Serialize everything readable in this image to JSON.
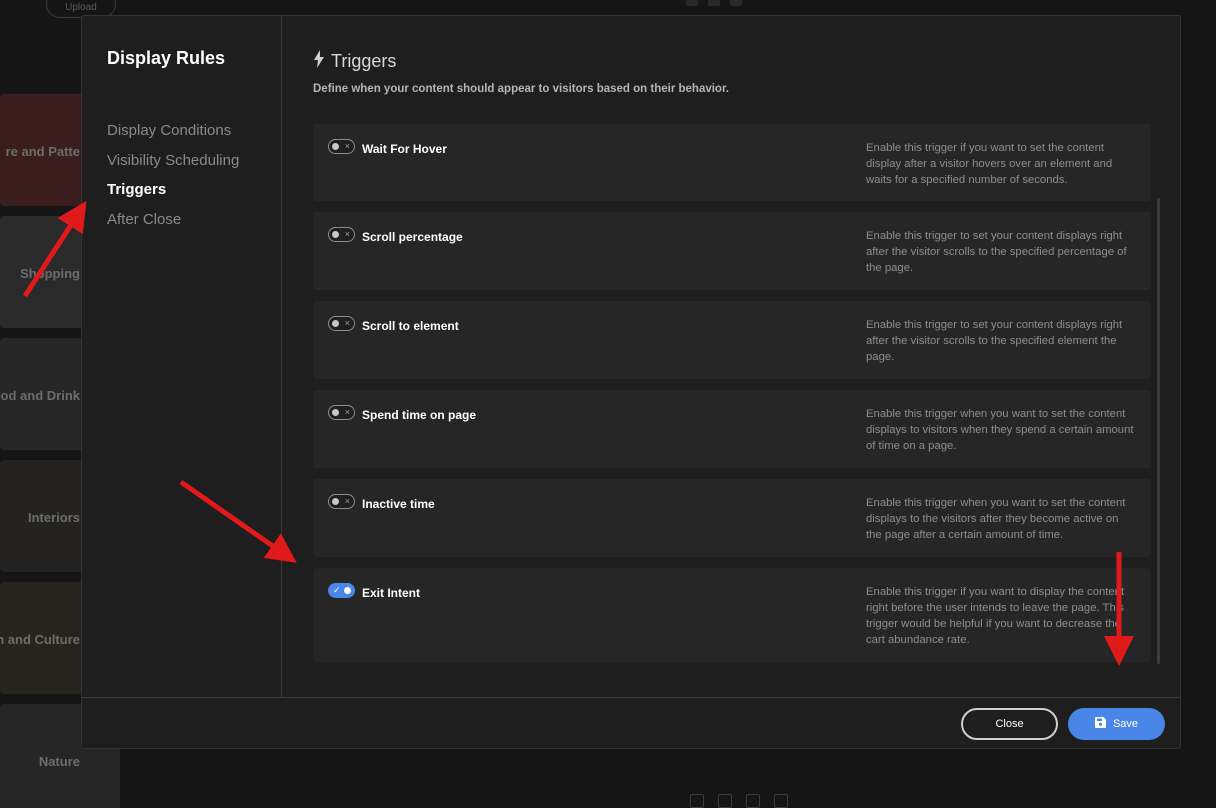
{
  "background": {
    "upload_label": "Upload",
    "categories": [
      {
        "label": "re and Patte",
        "color": "#3a1e1e"
      },
      {
        "label": "Shopping",
        "color": "#2a2a2a"
      },
      {
        "label": "od and Drink",
        "color": "#262626"
      },
      {
        "label": "Interiors",
        "color": "#252321"
      },
      {
        "label": "n and Culture",
        "color": "#27241f"
      },
      {
        "label": "Nature",
        "color": "#262626"
      }
    ]
  },
  "modal": {
    "title": "Display Rules",
    "nav": [
      {
        "label": "Display Conditions",
        "active": false
      },
      {
        "label": "Visibility Scheduling",
        "active": false
      },
      {
        "label": "Triggers",
        "active": true
      },
      {
        "label": "After Close",
        "active": false
      }
    ],
    "section": {
      "title": "Triggers",
      "icon": "lightning-icon",
      "description": "Define when your content should appear to visitors based on their behavior."
    },
    "triggers": [
      {
        "name": "Wait For Hover",
        "enabled": false,
        "description": "Enable this trigger if you want to set the content display after a visitor hovers over an element and waits for a specified number of seconds."
      },
      {
        "name": "Scroll percentage",
        "enabled": false,
        "description": "Enable this trigger to set your content displays right after the visitor scrolls to the specified percentage of the page."
      },
      {
        "name": "Scroll to element",
        "enabled": false,
        "description": "Enable this trigger to set your content displays right after the visitor scrolls to the specified element the page."
      },
      {
        "name": "Spend time on page",
        "enabled": false,
        "description": "Enable this trigger when you want to set the content displays to visitors when they spend a certain amount of time on a page."
      },
      {
        "name": "Inactive time",
        "enabled": false,
        "description": "Enable this trigger when you want to set the content displays to the visitors after they become active on the page after a certain amount of time."
      },
      {
        "name": "Exit Intent",
        "enabled": true,
        "description": "Enable this trigger if you want to display the content right before the user intends to leave the page. This trigger would be helpful if you want to decrease the cart abundance rate."
      }
    ],
    "footer": {
      "close_label": "Close",
      "save_label": "Save",
      "save_icon": "save-icon"
    }
  },
  "colors": {
    "accent": "#4a86e8",
    "annotation_arrow": "#e0191a",
    "modal_bg": "#1e1e1e",
    "card_bg": "#262626"
  }
}
